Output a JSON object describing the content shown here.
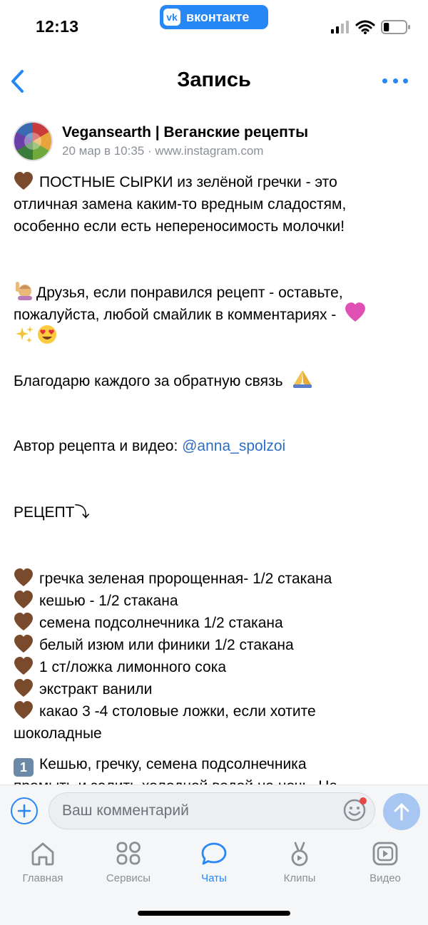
{
  "status_bar": {
    "time": "12:13",
    "app_pill": "вконтакте",
    "app_logo": "vk",
    "icons": [
      "signal-icon",
      "wifi-icon",
      "battery-icon"
    ],
    "battery_level": 0.25
  },
  "nav": {
    "title": "Запись",
    "back_icon": "chevron-left-icon",
    "more_icon": "more-dots-icon"
  },
  "post": {
    "author": "Vegansearth | Веганские рецепты",
    "date": "20 мар в 10:35",
    "separator": " · ",
    "source": "www.instagram.com",
    "intro_lines": [
      "ПОСТНЫЕ СЫРКИ из зелёной гречки - это",
      "отличная замена каким-то вредным сладостям,",
      "особенно если есть  непереносимость молочки!"
    ],
    "friends_lines": [
      "Друзья, если понравился рецепт - оставьте,",
      "пожалуйста, любой смайлик в комментариях -"
    ],
    "thanks": "Благодарю каждого за обратную связь",
    "author_line_prefix": "Автор рецепта и видео: ",
    "author_link": "@anna_spolzoi",
    "recipe_heading": "РЕЦЕПТ⤵",
    "ingredients": [
      "гречка зеленая пророщенная- 1/2 стакана",
      "кешью - 1/2 стакана",
      "семена подсолнечника 1/2 стакана",
      "белый изюм или финики 1/2 стакана",
      "1 ст/ложка лимонного сока",
      "экстракт ванили",
      "какао 3 -4 столовые ложки, если хотите"
    ],
    "ingredient_continuation": "шоколадные",
    "step_number": "1",
    "step_lines": [
      "Кешью, гречку, семена подсолнечника",
      "промыть и залить холодной водой на ночь. На"
    ]
  },
  "comment": {
    "placeholder": "Ваш комментарий"
  },
  "tabs": [
    {
      "label": "Главная",
      "icon": "home-icon",
      "active": false
    },
    {
      "label": "Сервисы",
      "icon": "services-icon",
      "active": false
    },
    {
      "label": "Чаты",
      "icon": "chat-icon",
      "active": true
    },
    {
      "label": "Клипы",
      "icon": "clips-icon",
      "active": false
    },
    {
      "label": "Видео",
      "icon": "video-icon",
      "active": false
    }
  ],
  "colors": {
    "accent": "#2787f5",
    "link": "#2d6ec5",
    "muted": "#8a8f96"
  }
}
